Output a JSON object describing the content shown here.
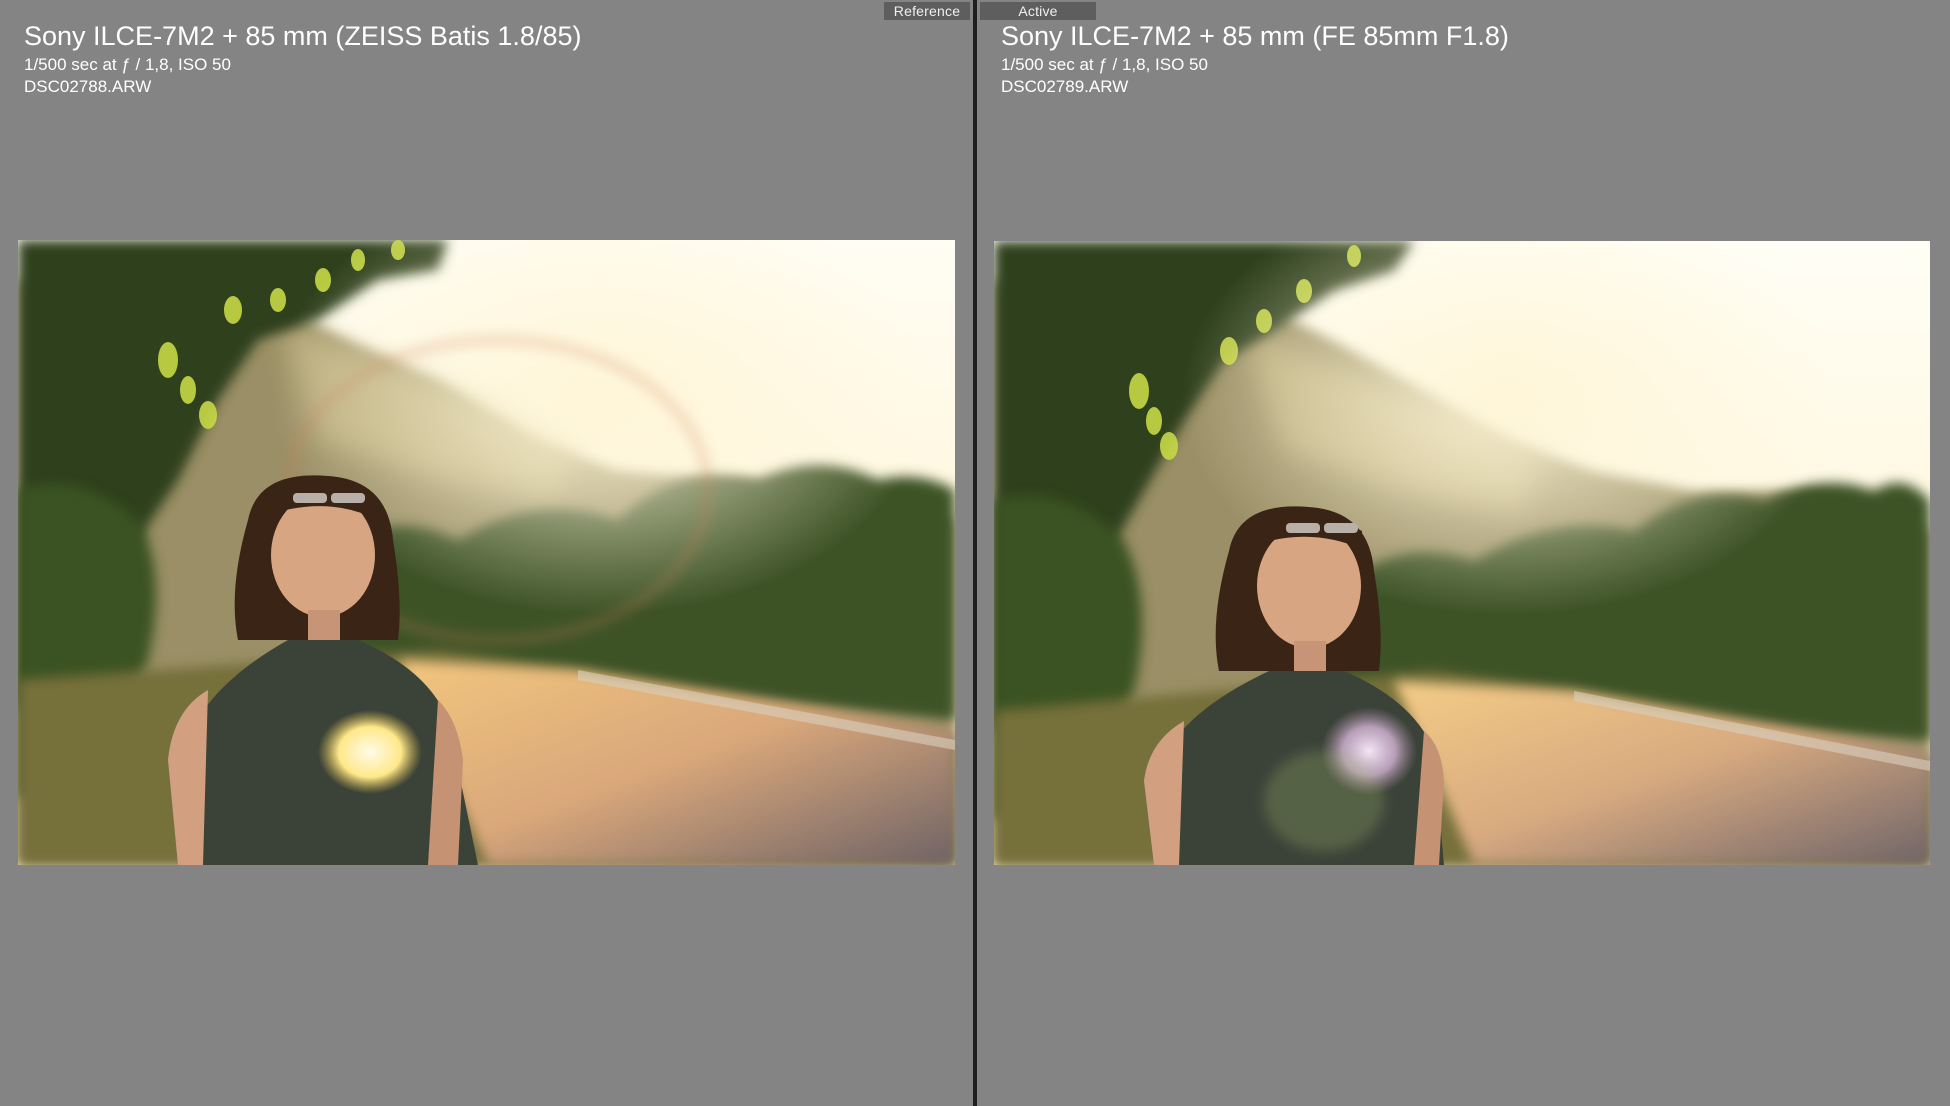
{
  "compare_view": {
    "reference_pane": {
      "tag_label": "Reference",
      "title": "Sony ILCE-7M2 + 85 mm (ZEISS Batis 1.8/85)",
      "exposure": "1/500 sec at ƒ / 1,8, ISO 50",
      "filename": "DSC02788.ARW"
    },
    "active_pane": {
      "tag_label": "Active",
      "title": "Sony ILCE-7M2 + 85 mm (FE 85mm F1.8)",
      "exposure": "1/500 sec at ƒ / 1,8, ISO 50",
      "filename": "DSC02789.ARW"
    }
  },
  "colors": {
    "pane_background": "#848484",
    "divider": "#1e1e1e",
    "tag_background": "#5e5e5e",
    "text": "#ffffff"
  }
}
